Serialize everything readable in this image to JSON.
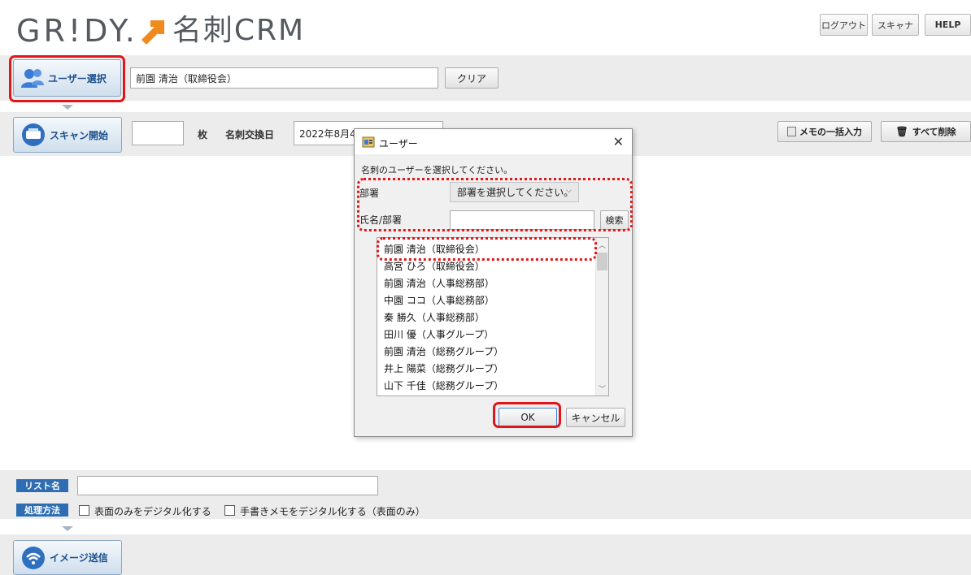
{
  "header": {
    "logo_text": "GR!DY.",
    "logo_product": "名刺CRM",
    "logout_label": "ログアウト",
    "scanner_label": "スキャナ",
    "help_label": "HELP"
  },
  "user_row": {
    "user_select_label": "ユーザー選択",
    "selected_user": "前園 清治（取締役会）",
    "clear_label": "クリア"
  },
  "scan_row": {
    "scan_start_label": "スキャン開始",
    "count_value": "",
    "count_unit": "枚",
    "exchange_date_label": "名刺交換日",
    "exchange_date_value": "2022年8月4",
    "memo_bulk_label": "メモの一括入力",
    "delete_all_label": "すべて削除"
  },
  "dialog": {
    "title": "ユーザー",
    "instruction": "名刺のユーザーを選択してください。",
    "dept_label": "部署",
    "dept_select_value": "部署を選択してください。",
    "name_label": "氏名/部署",
    "name_input_value": "",
    "search_label": "検索",
    "users": [
      "前園 清治（取締役会）",
      "高宮 ひろ（取締役会）",
      "前園 清治（人事総務部）",
      "中園 ココ（人事総務部）",
      "秦 勝久（人事総務部）",
      "田川 優（人事グループ）",
      "前園 清治（総務グループ）",
      "井上 陽菜（総務グループ）",
      "山下 千佳（総務グループ）"
    ],
    "ok_label": "OK",
    "cancel_label": "キャンセル"
  },
  "bottom": {
    "list_name_tag": "リスト名",
    "list_name_value": "",
    "process_tag": "処理方法",
    "option1_label": "表面のみをデジタル化する",
    "option2_label": "手書きメモをデジタル化する（表面のみ）",
    "send_label": "イメージ送信"
  },
  "colors": {
    "accent_blue": "#2e6db4",
    "highlight_red": "#e0161b",
    "logo_orange": "#f08a1c"
  }
}
